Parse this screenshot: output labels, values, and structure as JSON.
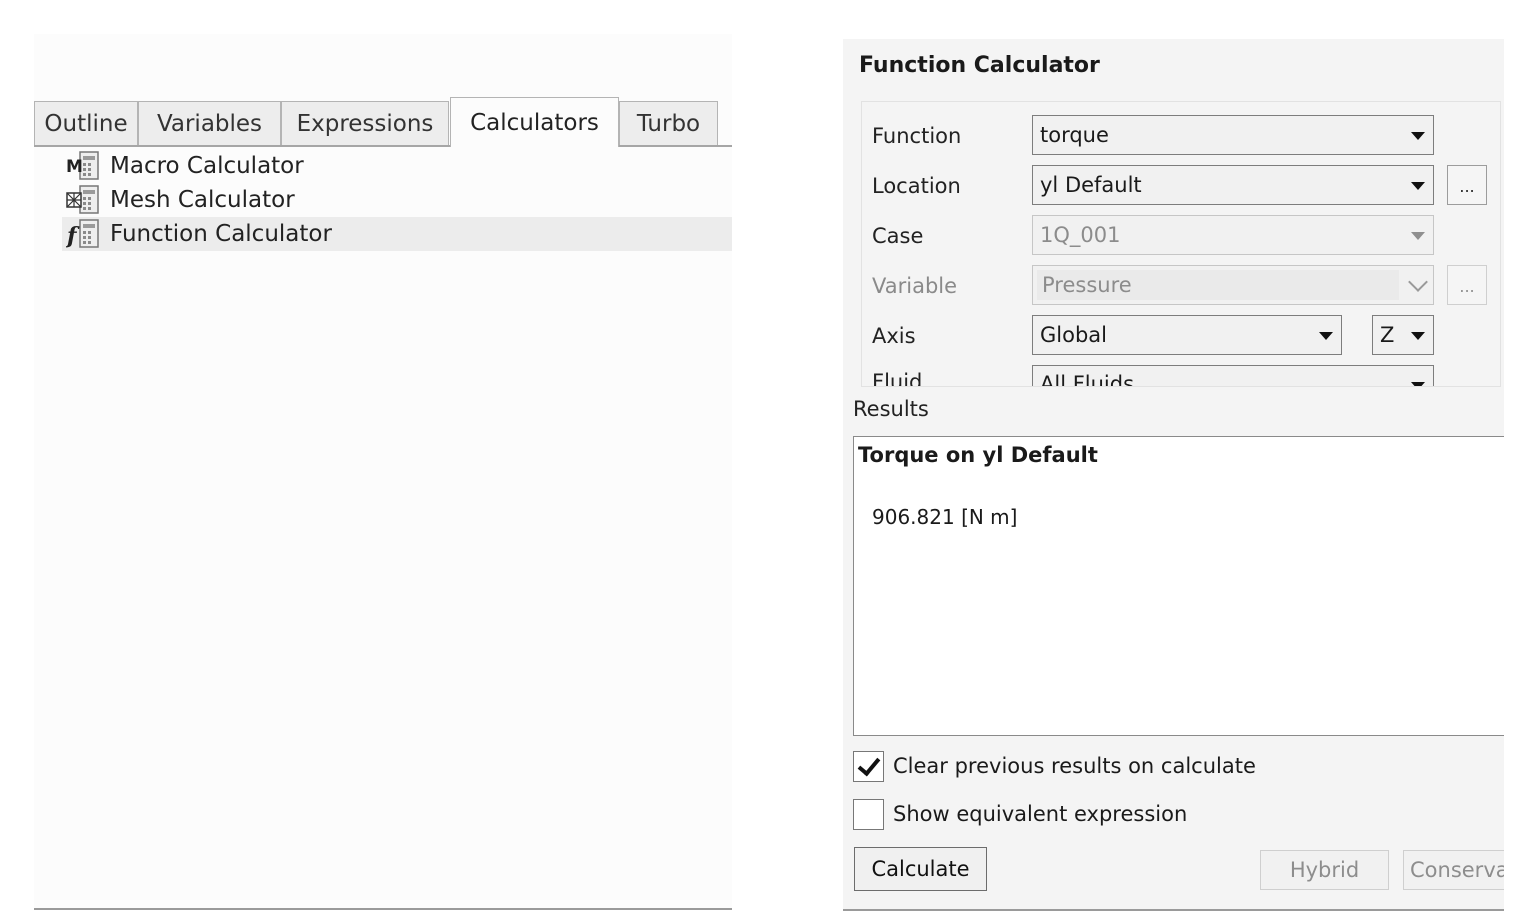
{
  "left_panel": {
    "tabs": [
      {
        "label": "Outline",
        "active": false
      },
      {
        "label": "Variables",
        "active": false
      },
      {
        "label": "Expressions",
        "active": false
      },
      {
        "label": "Calculators",
        "active": true
      },
      {
        "label": "Turbo",
        "active": false
      }
    ],
    "tree_items": [
      {
        "label": "Macro Calculator",
        "icon": "macro-calculator-icon",
        "selected": false
      },
      {
        "label": "Mesh Calculator",
        "icon": "mesh-calculator-icon",
        "selected": false
      },
      {
        "label": "Function Calculator",
        "icon": "function-calculator-icon",
        "selected": true
      }
    ]
  },
  "function_calculator": {
    "title": "Function Calculator",
    "rows": {
      "function": {
        "label": "Function",
        "value": "torque"
      },
      "location": {
        "label": "Location",
        "value": "yl Default",
        "browse": "..."
      },
      "case": {
        "label": "Case",
        "value": "1Q_001"
      },
      "variable": {
        "label": "Variable",
        "value": "Pressure",
        "browse": "..."
      },
      "axis": {
        "label": "Axis",
        "value": "Global",
        "component": "Z"
      },
      "fluid": {
        "label": "Fluid",
        "value": "All Fluids"
      }
    },
    "results": {
      "label": "Results",
      "title": "Torque on yl Default",
      "value": "906.821 [N m]"
    },
    "options": {
      "clear_previous": {
        "label": "Clear previous results on calculate",
        "checked": true
      },
      "show_expression": {
        "label": "Show equivalent expression",
        "checked": false
      }
    },
    "buttons": {
      "calculate": "Calculate",
      "hybrid": "Hybrid",
      "conservative": "Conservative"
    }
  },
  "colors": {
    "panel_background": "#f4f4f4",
    "selection": "#ececec",
    "disabled_text": "#8d8d8d"
  }
}
